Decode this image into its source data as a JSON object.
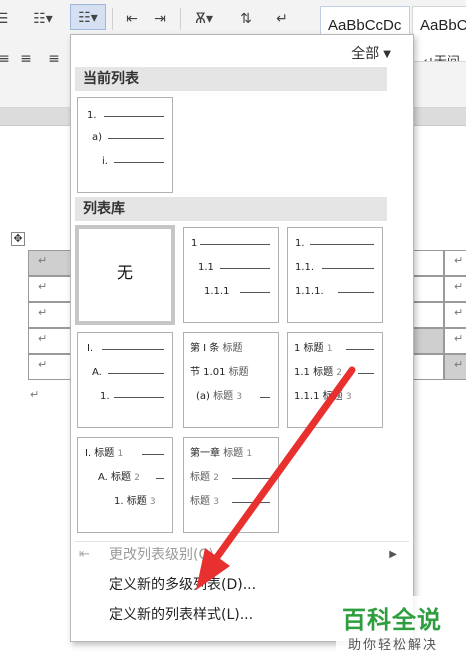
{
  "ribbon": {
    "style1": "AaBbCcDc",
    "style2": "AaBbCcDc",
    "style2_sub": "↵无间"
  },
  "panel": {
    "filter": "全部",
    "current_list_header": "当前列表",
    "current_list": [
      "1.",
      "a)",
      "i."
    ],
    "library_header": "列表库",
    "none_tile": "无",
    "tile_numeric": [
      "1",
      "1.1",
      "1.1.1"
    ],
    "tile_dotted": [
      "1.",
      "1.1.",
      "1.1.1."
    ],
    "tile_roman": [
      "I.",
      "A.",
      "1."
    ],
    "tile_article": {
      "l1_a": "第 I 条",
      "l1_b": "标题",
      "l2_a": "节 1.01",
      "l2_b": "标题",
      "l3_a": "(a)",
      "l3_b": "标题",
      "l3_c": "3"
    },
    "tile_heading_num": {
      "l1_a": "1 标题",
      "l1_b": "1",
      "l2_a": "1.1 标题",
      "l2_b": "2",
      "l3_a": "1.1.1 标题",
      "l3_b": "3"
    },
    "tile_heading_roman": {
      "l1_a": "I. 标题",
      "l1_b": "1",
      "l2_a": "A. 标题",
      "l2_b": "2",
      "l3_a": "1. 标题",
      "l3_b": "3"
    },
    "tile_chapter": {
      "l1_a": "第一章",
      "l1_b": "标题",
      "l1_c": "1",
      "l2_a": "标题",
      "l2_b": "2",
      "l3_a": "标题",
      "l3_b": "3"
    },
    "menu": {
      "change_level": "更改列表级别(C)",
      "define_multilevel": "定义新的多级列表(D)...",
      "define_style": "定义新的列表样式(L)..."
    }
  },
  "doc": {
    "cell_mark": "↵",
    "handle": "✥",
    "para_mark": "↵"
  },
  "watermark": {
    "title": "百科全说",
    "subtitle": "助你轻松解决"
  },
  "colors": {
    "arrow": "#e8302e",
    "watermark": "#2e9e3f"
  }
}
